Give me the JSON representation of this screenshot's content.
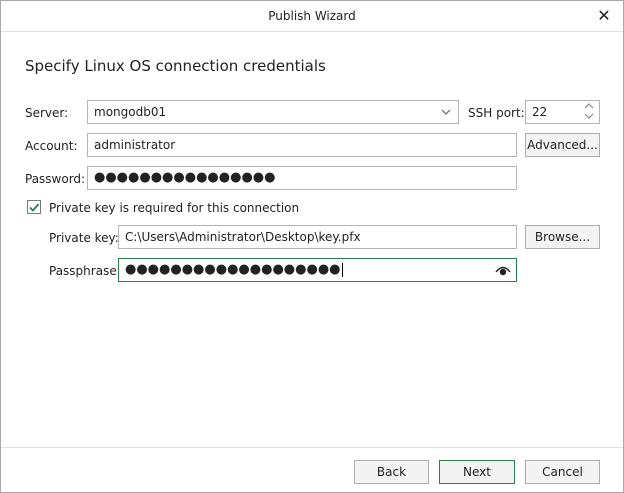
{
  "window": {
    "title": "Publish Wizard"
  },
  "page": {
    "heading": "Specify Linux OS connection credentials"
  },
  "form": {
    "server_label": "Server:",
    "server_value": "mongodb01",
    "ssh_port_label": "SSH port:",
    "ssh_port_value": "22",
    "account_label": "Account:",
    "account_value": "administrator",
    "advanced_button": "Advanced...",
    "password_label": "Password:",
    "password_value": "●●●●●●●●●●●●●●●●",
    "private_key_checkbox_label": "Private key is required for this connection",
    "private_key_checked": true,
    "private_key_label": "Private key:",
    "private_key_value": "C:\\Users\\Administrator\\Desktop\\key.pfx",
    "browse_button": "Browse...",
    "passphrase_label": "Passphrase:",
    "passphrase_value": "●●●●●●●●●●●●●●●●●●●"
  },
  "footer": {
    "back_button": "Back",
    "next_button": "Next",
    "cancel_button": "Cancel"
  },
  "icons": {
    "close": "close-icon",
    "dropdown": "chevron-down-icon",
    "spin_up": "chevron-up-icon",
    "spin_down": "chevron-down-icon",
    "checkbox": "checkmark-icon",
    "reveal": "eye-icon"
  },
  "colors": {
    "accent": "#2e7d4f",
    "check": "#2e7d4f"
  }
}
